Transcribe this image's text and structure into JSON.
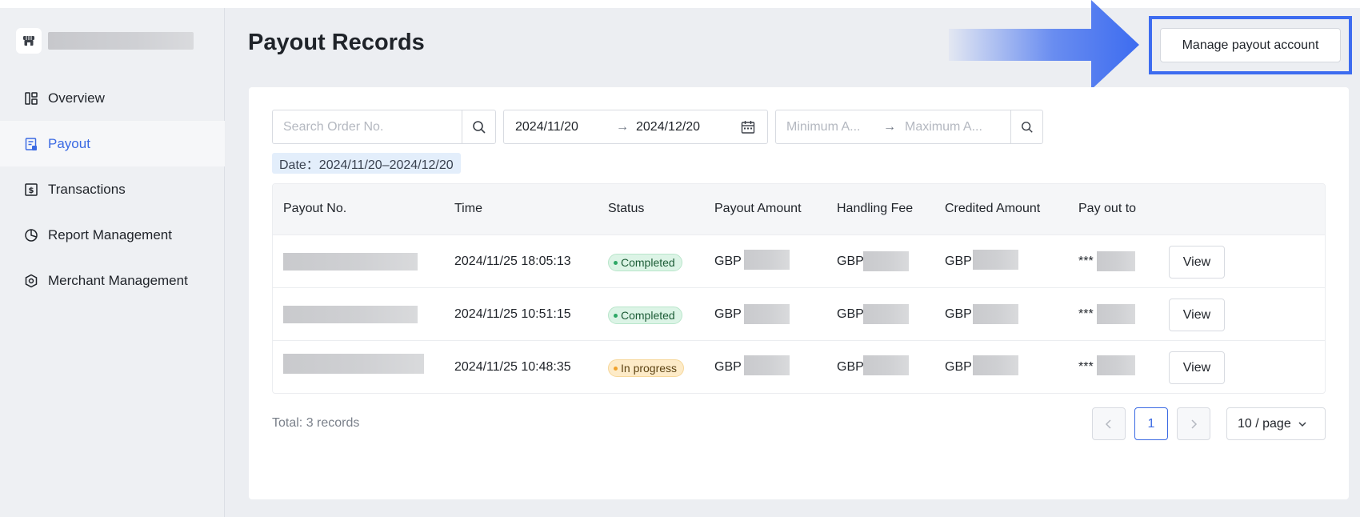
{
  "sidebar": {
    "items": [
      {
        "label": "Overview",
        "icon": "layout-icon",
        "active": false
      },
      {
        "label": "Payout",
        "icon": "document-icon",
        "active": true
      },
      {
        "label": "Transactions",
        "icon": "dollar-icon",
        "active": false
      },
      {
        "label": "Report Management",
        "icon": "pie-chart-icon",
        "active": false
      },
      {
        "label": "Merchant Management",
        "icon": "hexagon-icon",
        "active": false
      }
    ]
  },
  "header": {
    "title": "Payout Records",
    "manage_button": "Manage payout account"
  },
  "filters": {
    "search_placeholder": "Search Order No.",
    "date_start": "2024/11/20",
    "date_end": "2024/12/20",
    "range_separator": "→",
    "min_amount_placeholder": "Minimum A...",
    "max_amount_placeholder": "Maximum A...",
    "active_tag": "Date：2024/11/20–2024/12/20"
  },
  "table": {
    "columns": [
      "Payout No.",
      "Time",
      "Status",
      "Payout Amount",
      "Handling Fee",
      "Credited Amount",
      "Pay out to"
    ],
    "rows": [
      {
        "time": "2024/11/25 18:05:13",
        "status": "Completed",
        "status_type": "completed",
        "currency": "GBP",
        "pay_out_to": "***",
        "action": "View"
      },
      {
        "time": "2024/11/25 10:51:15",
        "status": "Completed",
        "status_type": "completed",
        "currency": "GBP",
        "pay_out_to": "***",
        "action": "View"
      },
      {
        "time": "2024/11/25 10:48:35",
        "status": "In progress",
        "status_type": "in-progress",
        "currency": "GBP",
        "pay_out_to": "***",
        "action": "View"
      }
    ]
  },
  "pagination": {
    "total_text": "Total: 3 records",
    "current_page": "1",
    "page_size": "10 / page"
  },
  "colors": {
    "accent": "#3b6ae3",
    "highlight": "#3d6cf0",
    "completed": "#2ea866",
    "in_progress": "#f0a12a"
  }
}
